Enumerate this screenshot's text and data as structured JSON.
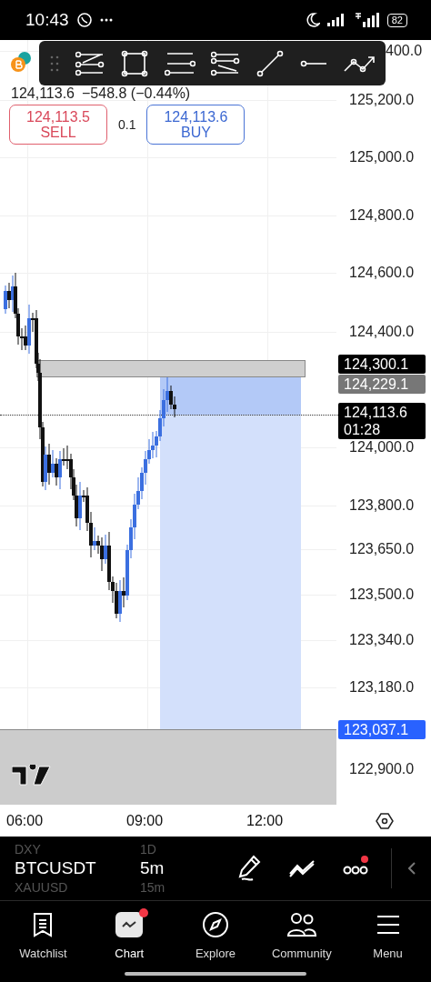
{
  "status_bar": {
    "time": "10:43",
    "battery": "82"
  },
  "symbol": {
    "quote": "124,113.6",
    "change": "−548.8 (−0.44%)"
  },
  "trade": {
    "sell_price": "124,113.5",
    "sell_label": "SELL",
    "quantity": "0.1",
    "buy_price": "124,113.6",
    "buy_label": "BUY"
  },
  "price_axis": [
    "400.0",
    "125,200.0",
    "125,000.0",
    "124,800.0",
    "124,600.0",
    "124,400.0",
    "124,000.0",
    "123,800.0",
    "123,650.0",
    "123,500.0",
    "123,340.0",
    "123,180.0",
    "122,900.0"
  ],
  "price_tags": [
    {
      "kind": "alert",
      "price": "124,300.1"
    },
    {
      "kind": "level",
      "price": "124,229.1"
    },
    {
      "kind": "last",
      "price": "124,113.6",
      "countdown": "01:28"
    },
    {
      "kind": "target",
      "price": "123,037.1"
    }
  ],
  "time_axis": [
    "06:00",
    "09:00",
    "12:00"
  ],
  "symbols": [
    {
      "name": "DXY",
      "interval": "1D",
      "selected": false
    },
    {
      "name": "BTCUSDT",
      "interval": "5m",
      "selected": true
    },
    {
      "name": "XAUUSD",
      "interval": "15m",
      "selected": false
    }
  ],
  "tools": [
    {
      "kind": "draw",
      "badge": false
    },
    {
      "kind": "patterns",
      "badge": false
    },
    {
      "kind": "more",
      "badge": true
    }
  ],
  "nav": [
    {
      "label": "Watchlist",
      "kind": "watchlist",
      "selected": false,
      "badge": false
    },
    {
      "label": "Chart",
      "kind": "chart",
      "selected": true,
      "badge": true
    },
    {
      "label": "Explore",
      "kind": "explore",
      "selected": false,
      "badge": false
    },
    {
      "label": "Community",
      "kind": "community",
      "selected": false,
      "badge": false
    },
    {
      "label": "Menu",
      "kind": "menu",
      "selected": false,
      "badge": false
    }
  ]
}
